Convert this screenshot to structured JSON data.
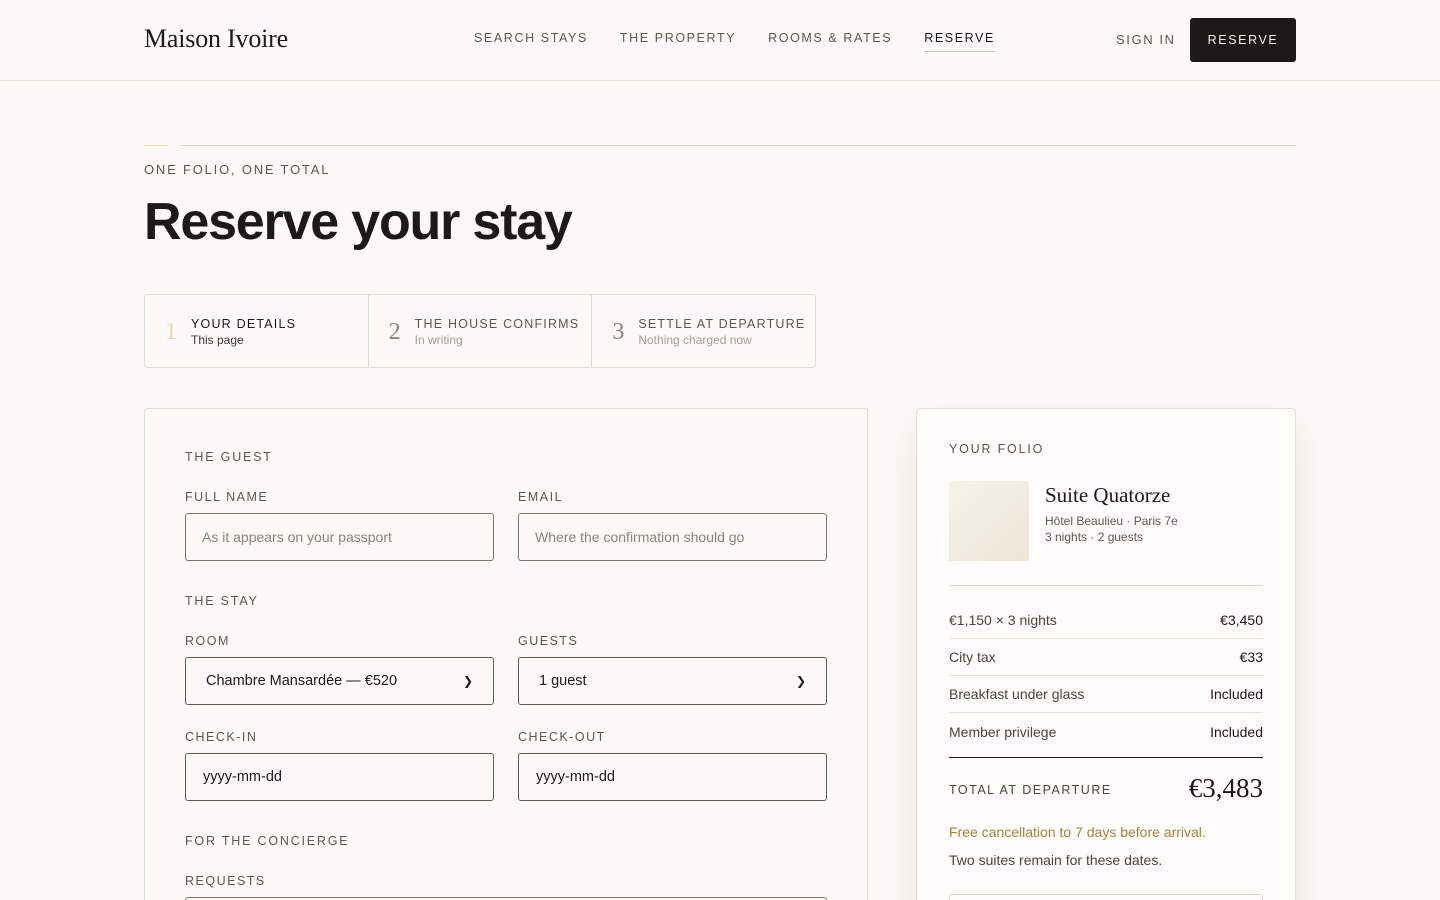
{
  "header": {
    "brand": "Maison Ivoire",
    "nav": [
      "SEARCH STAYS",
      "THE PROPERTY",
      "ROOMS & RATES",
      "RESERVE"
    ],
    "active_nav": "RESERVE",
    "sign_in": "SIGN IN",
    "reserve_button": "RESERVE"
  },
  "hero": {
    "eyebrow": "ONE FOLIO, ONE TOTAL",
    "title": "Reserve your stay"
  },
  "steps": [
    {
      "number": "1",
      "label": "YOUR DETAILS",
      "sub": "This page"
    },
    {
      "number": "2",
      "label": "THE HOUSE CONFIRMS",
      "sub": "In writing"
    },
    {
      "number": "3",
      "label": "SETTLE AT DEPARTURE",
      "sub": "Nothing charged now"
    }
  ],
  "form": {
    "guest_section": "THE GUEST",
    "full_name": {
      "label": "FULL NAME",
      "placeholder": "As it appears on your passport",
      "value": ""
    },
    "email": {
      "label": "EMAIL",
      "placeholder": "Where the confirmation should go",
      "value": ""
    },
    "stay_section": "THE STAY",
    "room": {
      "label": "ROOM",
      "value": "Chambre Mansardée — €520"
    },
    "guests": {
      "label": "GUESTS",
      "value": "1 guest"
    },
    "check_in": {
      "label": "CHECK-IN",
      "value": "yyyy-mm-dd"
    },
    "check_out": {
      "label": "CHECK-OUT",
      "value": "yyyy-mm-dd"
    },
    "concierge_section": "FOR THE CONCIERGE",
    "requests": {
      "label": "REQUESTS"
    }
  },
  "folio": {
    "eyebrow": "YOUR FOLIO",
    "suite_name": "Suite Quatorze",
    "hotel": "Hôtel Beaulieu · Paris 7e",
    "stay_summary": "3 nights · 2 guests",
    "lines": [
      {
        "label": "€1,150 × 3 nights",
        "value": "€3,450"
      },
      {
        "label": "City tax",
        "value": "€33"
      },
      {
        "label": "Breakfast under glass",
        "value": "Included"
      },
      {
        "label": "Member privilege",
        "value": "Included"
      }
    ],
    "total_label": "TOTAL AT DEPARTURE",
    "total_value": "€3,483",
    "cancellation": "Free cancellation to 7 days before arrival.",
    "availability": "Two suites remain for these dates."
  },
  "colors": {
    "background": "#fbfaf6",
    "ink": "#1c1a17",
    "accent_gold": "#a5823f",
    "border": "#e0dbd1"
  }
}
